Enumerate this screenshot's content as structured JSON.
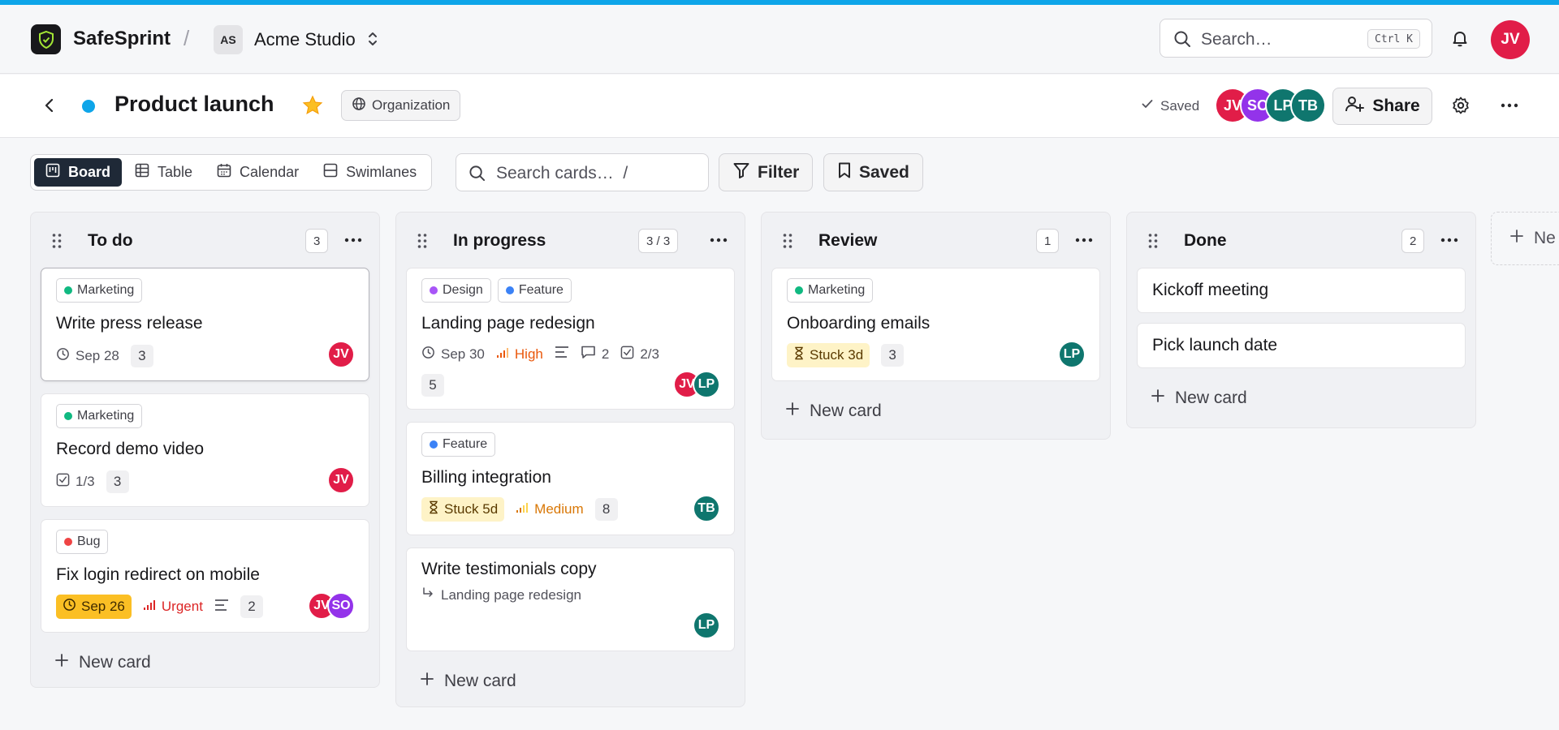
{
  "app": {
    "brand": "SafeSprint",
    "separator": "/",
    "workspace_initials": "AS",
    "workspace_name": "Acme Studio"
  },
  "topbar": {
    "search_placeholder": "Search…",
    "search_shortcut": "Ctrl K",
    "user_initials": "JV"
  },
  "project": {
    "title": "Product launch",
    "visibility": "Organization",
    "saved_label": "Saved",
    "members": [
      {
        "initials": "JV",
        "color": "#e11d48"
      },
      {
        "initials": "SO",
        "color": "#9333ea"
      },
      {
        "initials": "LP",
        "color": "#0f766e"
      },
      {
        "initials": "TB",
        "color": "#0f766e"
      }
    ],
    "share_label": "Share"
  },
  "views": {
    "tabs": [
      {
        "label": "Board",
        "active": true,
        "icon": "board-icon"
      },
      {
        "label": "Table",
        "active": false,
        "icon": "table-icon"
      },
      {
        "label": "Calendar",
        "active": false,
        "icon": "calendar-icon"
      },
      {
        "label": "Swimlanes",
        "active": false,
        "icon": "swimlanes-icon"
      }
    ],
    "card_search_placeholder": "Search cards…  /",
    "filter_label": "Filter",
    "saved_label": "Saved"
  },
  "colors": {
    "accent": "#0ea5e9",
    "urgent": "#dc2626",
    "high": "#ea580c",
    "medium": "#d97706",
    "marketing": "#10b981",
    "design": "#a855f7",
    "feature": "#3b82f6",
    "bug": "#ef4444"
  },
  "columns": {
    "todo": {
      "title": "To do",
      "count": "3",
      "new_card": "New card",
      "cards": [
        {
          "label": "Marketing",
          "title": "Write press release",
          "due": "Sep 28",
          "comments": "3",
          "assignee": "JV"
        },
        {
          "label": "Marketing",
          "title": "Record demo video",
          "checklist": "1/3",
          "comments": "3",
          "assignee": "JV"
        },
        {
          "label": "Bug",
          "title": "Fix login redirect on mobile",
          "due": "Sep 26",
          "priority": "Urgent",
          "comments": "2",
          "assignees": [
            "JV",
            "SO"
          ]
        }
      ]
    },
    "inprogress": {
      "title": "In progress",
      "count": "3 / 3",
      "new_card": "New card",
      "cards": [
        {
          "labels": [
            "Design",
            "Feature"
          ],
          "title": "Landing page redesign",
          "due": "Sep 30",
          "priority": "High",
          "attachments": "2",
          "checklist": "2/3",
          "comments": "5",
          "assignees": [
            "JV",
            "LP"
          ]
        },
        {
          "label": "Feature",
          "title": "Billing integration",
          "stuck": "Stuck 5d",
          "priority": "Medium",
          "comments": "8",
          "assignee": "TB"
        },
        {
          "title": "Write testimonials copy",
          "parent": "Landing page redesign",
          "assignee": "LP"
        }
      ]
    },
    "review": {
      "title": "Review",
      "count": "1",
      "new_card": "New card",
      "cards": [
        {
          "label": "Marketing",
          "title": "Onboarding emails",
          "stuck": "Stuck 3d",
          "comments": "3",
          "assignee": "LP"
        }
      ]
    },
    "done": {
      "title": "Done",
      "count": "2",
      "new_card": "New card",
      "cards": [
        {
          "title": "Kickoff meeting"
        },
        {
          "title": "Pick launch date"
        }
      ]
    }
  },
  "new_column_label": "Ne"
}
